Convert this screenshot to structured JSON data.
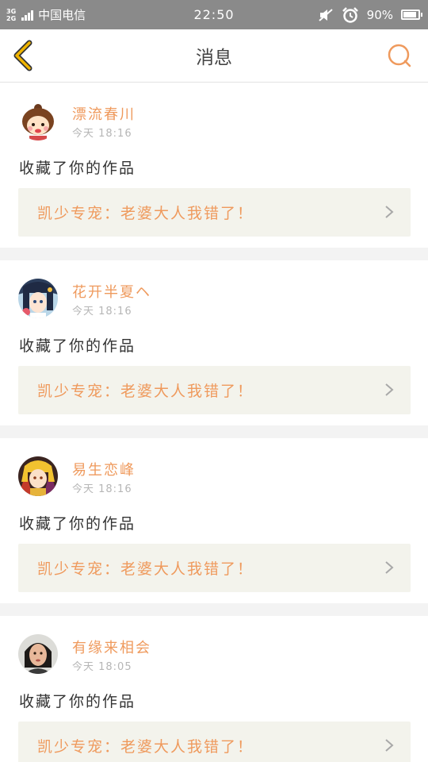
{
  "status_bar": {
    "net_top": "3G",
    "net_bottom": "2G",
    "carrier": "中国电信",
    "time": "22:50",
    "battery": "90%",
    "battery_level": 0.9
  },
  "nav": {
    "title": "消息",
    "back_icon": "chevron-left-icon",
    "search_icon": "search-icon"
  },
  "colors": {
    "accent": "#ef9a5d",
    "back_accent": "#f0b400",
    "status_bar": "#8a8a8a",
    "card_work_bg": "#f3f3ec"
  },
  "messages": [
    {
      "username": "漂流春川",
      "time": "今天 18:16",
      "action": "收藏了你的作品",
      "work_title": "凯少专宠：老婆大人我错了！"
    },
    {
      "username": "花开半夏ヘ",
      "time": "今天 18:16",
      "action": "收藏了你的作品",
      "work_title": "凯少专宠：老婆大人我错了！"
    },
    {
      "username": "易生恋峰",
      "time": "今天 18:16",
      "action": "收藏了你的作品",
      "work_title": "凯少专宠：老婆大人我错了！"
    },
    {
      "username": "有缘来相会",
      "time": "今天 18:05",
      "action": "收藏了你的作品",
      "work_title": "凯少专宠：老婆大人我错了！"
    }
  ]
}
